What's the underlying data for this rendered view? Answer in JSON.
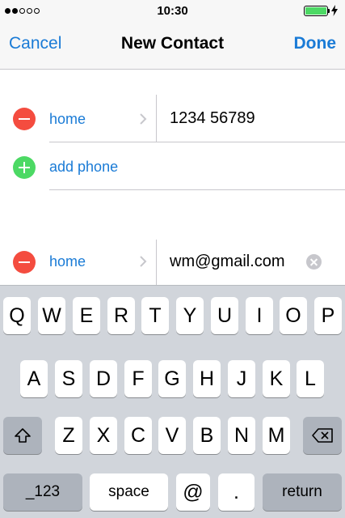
{
  "status_bar": {
    "time": "10:30",
    "signal_bars": 5,
    "signal_filled": 2,
    "battery_level": 1.0,
    "battery_color": "#4cd964",
    "icons": [
      "signal-dots-icon",
      "battery-icon",
      "charging-bolt-icon"
    ]
  },
  "nav": {
    "cancel_label": "Cancel",
    "title": "New Contact",
    "done_label": "Done",
    "accent_color": "#1a7bd6"
  },
  "form": {
    "phone": {
      "label": "home",
      "value": "1234 56789"
    },
    "add_phone_label": "add phone",
    "email": {
      "label": "home",
      "value": "wm@gmail.com"
    }
  },
  "keyboard": {
    "row1": [
      "Q",
      "W",
      "E",
      "R",
      "T",
      "Y",
      "U",
      "I",
      "O",
      "P"
    ],
    "row2": [
      "A",
      "S",
      "D",
      "F",
      "G",
      "H",
      "J",
      "K",
      "L"
    ],
    "row3": [
      "Z",
      "X",
      "C",
      "V",
      "B",
      "N",
      "M"
    ],
    "numbers_label": "_123",
    "space_label": "space",
    "at_label": "@",
    "dot_label": ".",
    "return_label": "return"
  }
}
